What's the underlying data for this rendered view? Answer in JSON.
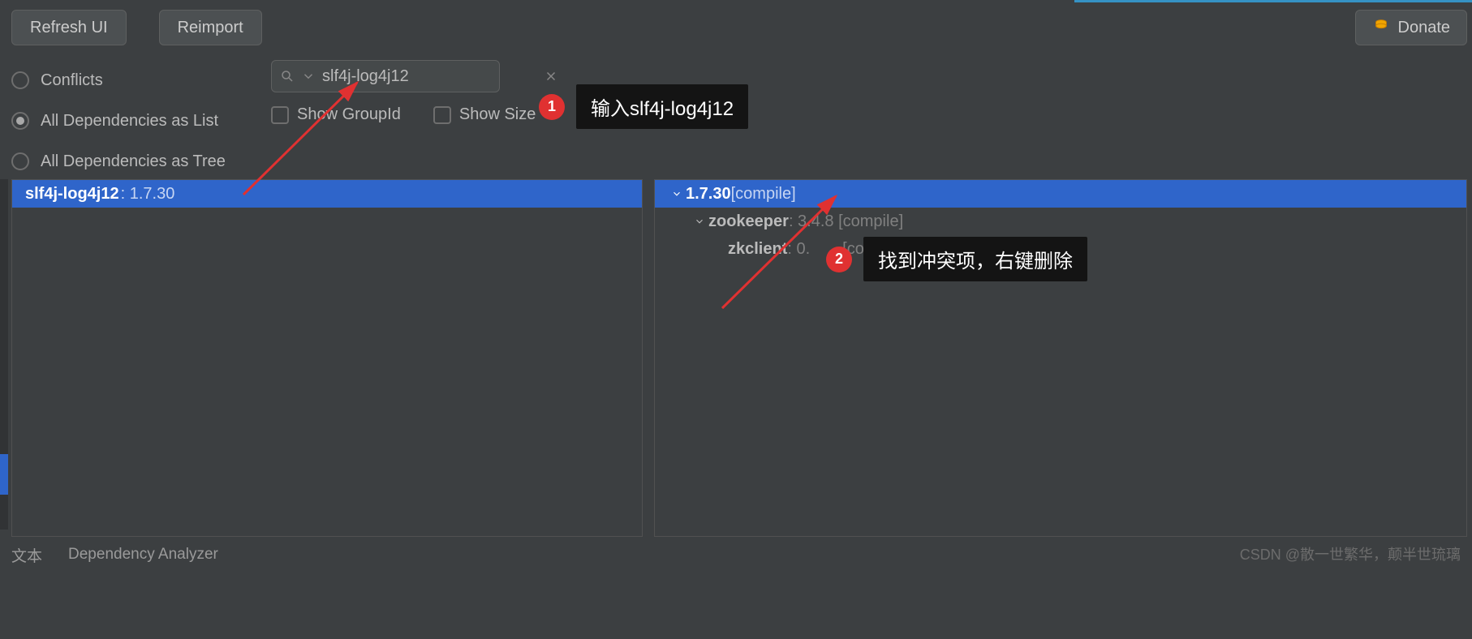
{
  "top_blue_visible": true,
  "toolbar": {
    "refresh_label": "Refresh UI",
    "reimport_label": "Reimport",
    "donate_label": "Donate"
  },
  "filters": {
    "radios": {
      "conflicts": "Conflicts",
      "all_list": "All Dependencies as List",
      "all_tree": "All Dependencies as Tree",
      "selected": "all_list"
    },
    "search_value": "slf4j-log4j12",
    "show_groupid": "Show GroupId",
    "show_size": "Show Size"
  },
  "left_panel": {
    "item_name": "slf4j-log4j12",
    "item_version_text": " : 1.7.30"
  },
  "right_panel": {
    "root": {
      "version": "1.7.30",
      "scope": " [compile]"
    },
    "child1": {
      "name": "zookeeper",
      "rest": " : 3.4.8 [compile]"
    },
    "child2": {
      "name": "zkclient",
      "rest_a": " : 0.",
      "rest_b": " [co"
    }
  },
  "annotations": {
    "step1_num": "1",
    "step1_text": "输入slf4j-log4j12",
    "step2_num": "2",
    "step2_text": "找到冲突项，右键删除"
  },
  "footer": {
    "tab1": "文本",
    "tab2": "Dependency Analyzer"
  },
  "watermark": "CSDN @散一世繁华，颠半世琉璃"
}
